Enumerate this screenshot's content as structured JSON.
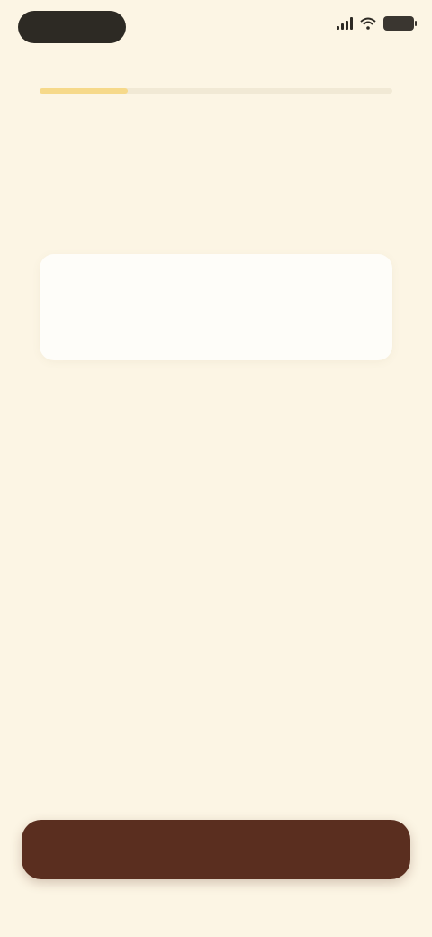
{
  "status_bar": {
    "icons": [
      "signal-icon",
      "wifi-icon",
      "battery-icon"
    ]
  },
  "progress": {
    "fraction": 0.25,
    "color": "#f6d98a"
  },
  "question": {
    "title": ""
  },
  "input": {
    "label": "",
    "value": "",
    "unit": ""
  },
  "helper": {
    "text": ""
  },
  "next_button": {
    "label": "",
    "color": "#5a2e1f"
  }
}
